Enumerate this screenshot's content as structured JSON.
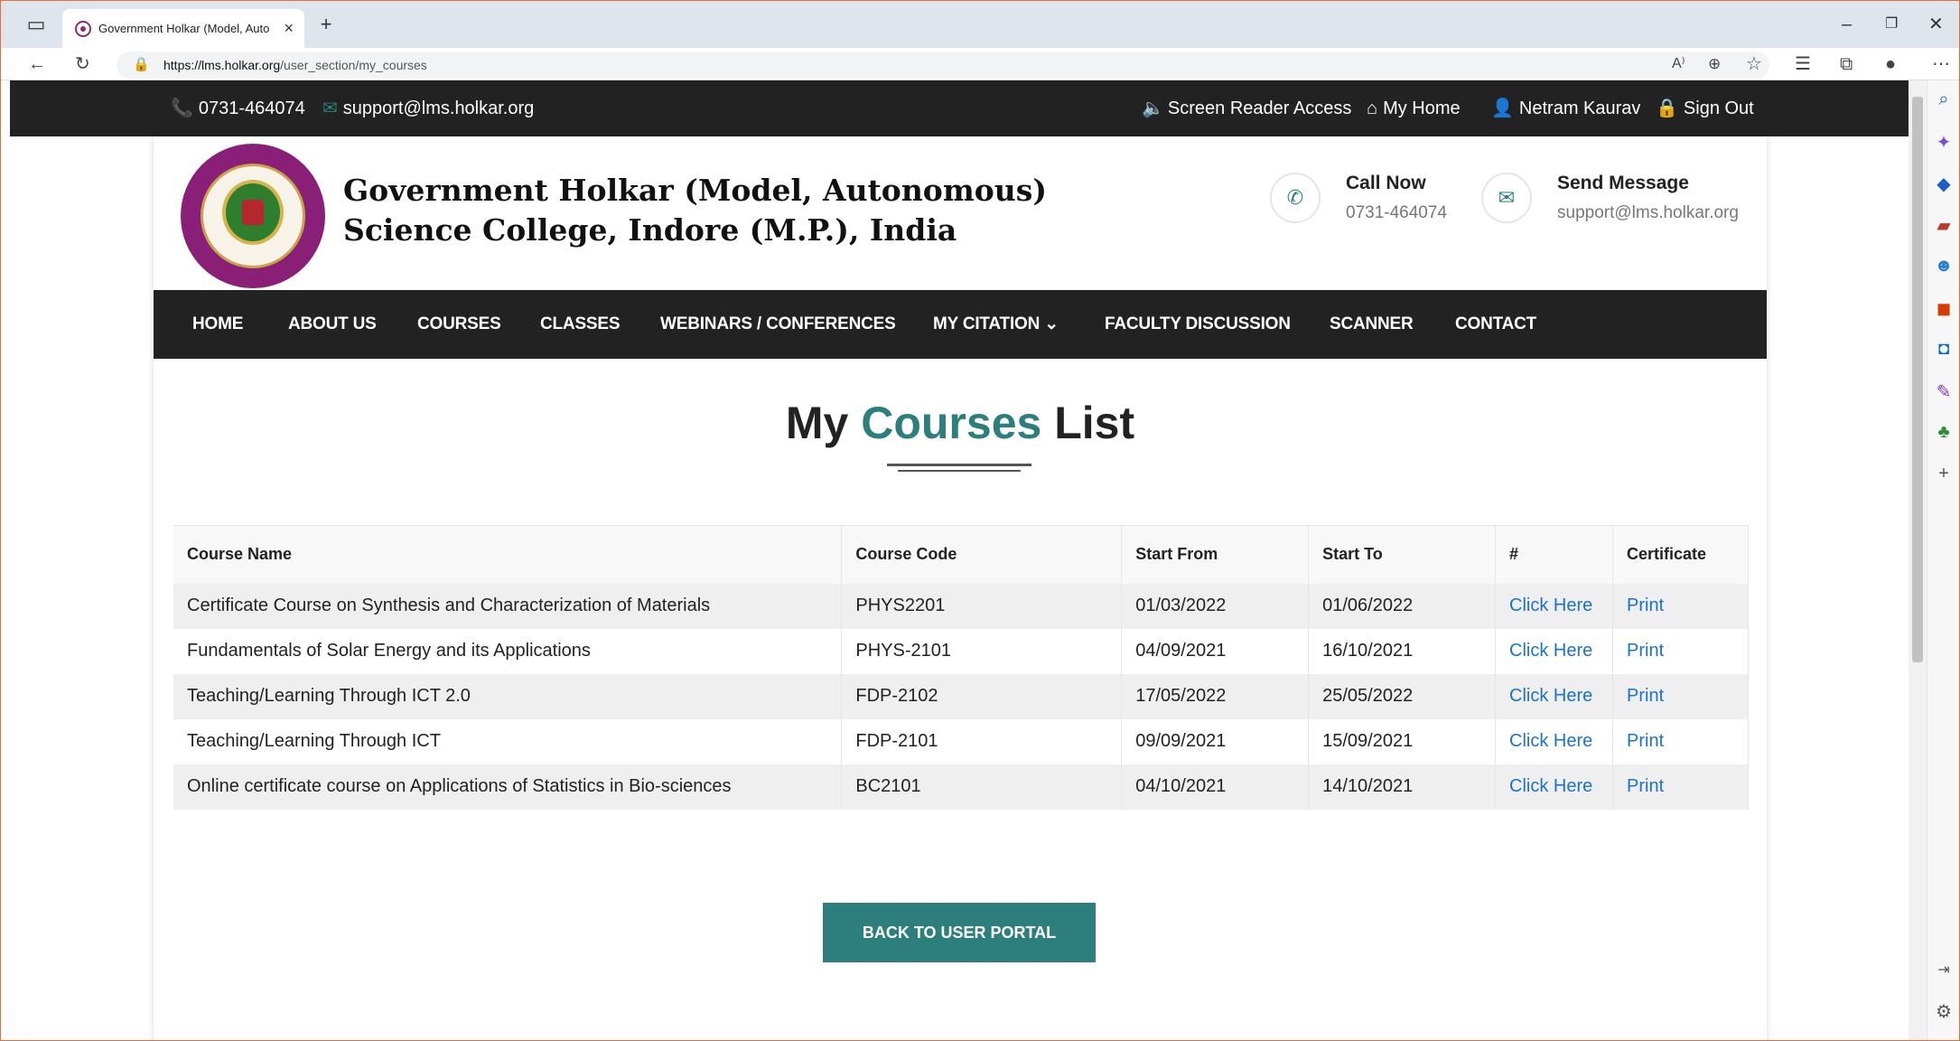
{
  "browser": {
    "tab_title": "Government Holkar (Model, Auto",
    "url_domain": "https://lms.holkar.org",
    "url_path": "/user_section/my_courses",
    "new_tab": "+",
    "tab_close": "×"
  },
  "topbar": {
    "phone": "0731-464074",
    "email": "support@lms.holkar.org",
    "screen_reader": "Screen Reader Access",
    "my_home": "My Home",
    "user": "Netram Kaurav",
    "sign_out": "Sign Out"
  },
  "header": {
    "college_line1": "Government Holkar (Model, Autonomous)",
    "college_line2": "Science College, Indore (M.P.), India",
    "call_title": "Call Now",
    "call_value": "0731-464074",
    "msg_title": "Send Message",
    "msg_value": "support@lms.holkar.org"
  },
  "nav": {
    "home": "HOME",
    "about": "ABOUT US",
    "courses": "COURSES",
    "classes": "CLASSES",
    "webinars": "WEBINARS / CONFERENCES",
    "citation": "MY CITATION ⌄",
    "faculty": "FACULTY DISCUSSION",
    "scanner": "SCANNER",
    "contact": "CONTACT"
  },
  "page": {
    "heading_pre": "My ",
    "heading_accent": "Courses",
    "heading_post": " List",
    "back_button": "BACK TO USER PORTAL"
  },
  "table": {
    "headers": [
      "Course Name",
      "Course Code",
      "Start From",
      "Start To",
      "#",
      "Certificate"
    ],
    "rows": [
      [
        "Certificate Course on Synthesis and Characterization of Materials",
        "PHYS2201",
        "01/03/2022",
        "01/06/2022",
        "Click Here",
        "Print"
      ],
      [
        "Fundamentals of Solar Energy and its Applications",
        "PHYS-2101",
        "04/09/2021",
        "16/10/2021",
        "Click Here",
        "Print"
      ],
      [
        "Teaching/Learning Through ICT 2.0",
        "FDP-2102",
        "17/05/2022",
        "25/05/2022",
        "Click Here",
        "Print"
      ],
      [
        "Teaching/Learning Through ICT",
        "FDP-2101",
        "09/09/2021",
        "15/09/2021",
        "Click Here",
        "Print"
      ],
      [
        "Online certificate course on Applications of Statistics in Bio-sciences",
        "BC2101",
        "04/10/2021",
        "14/10/2021",
        "Click Here",
        "Print"
      ]
    ]
  },
  "colors": {
    "accent": "#2c7f7d",
    "link": "#1a73c8",
    "dark": "#222222",
    "logo": "#8a1f78"
  }
}
